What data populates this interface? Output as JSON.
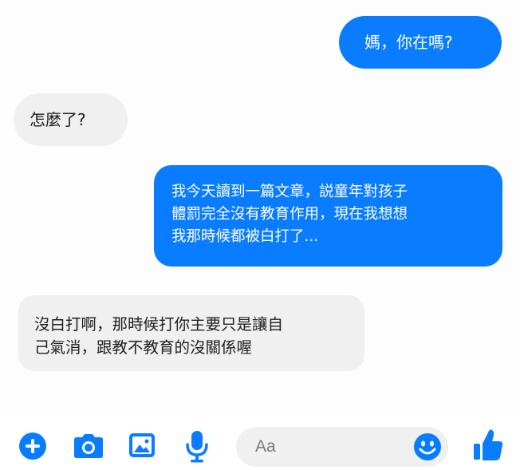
{
  "messages": [
    {
      "id": "m1",
      "direction": "outgoing",
      "lines": [
        "媽，你在嗎?"
      ]
    },
    {
      "id": "m2",
      "direction": "incoming",
      "lines": [
        "怎麼了?"
      ]
    },
    {
      "id": "m3",
      "direction": "outgoing",
      "lines": [
        "我今天讀到一篇文章，説童年對孩子",
        "體罰完全沒有教育作用，現在我想想",
        "我那時候都被白打了..."
      ]
    },
    {
      "id": "m4",
      "direction": "incoming",
      "lines": [
        "沒白打啊，那時候打你主要只是讓自",
        "己氣消，跟教不教育的沒關係喔"
      ]
    }
  ],
  "composer": {
    "placeholder": "Aa",
    "icons": [
      "plus-icon",
      "camera-icon",
      "image-icon",
      "microphone-icon",
      "emoji-icon",
      "thumbs-up-icon"
    ]
  },
  "colors": {
    "accent": "#0a7cff",
    "incoming_bubble": "#f0f0f0",
    "background": "#ffffff"
  }
}
